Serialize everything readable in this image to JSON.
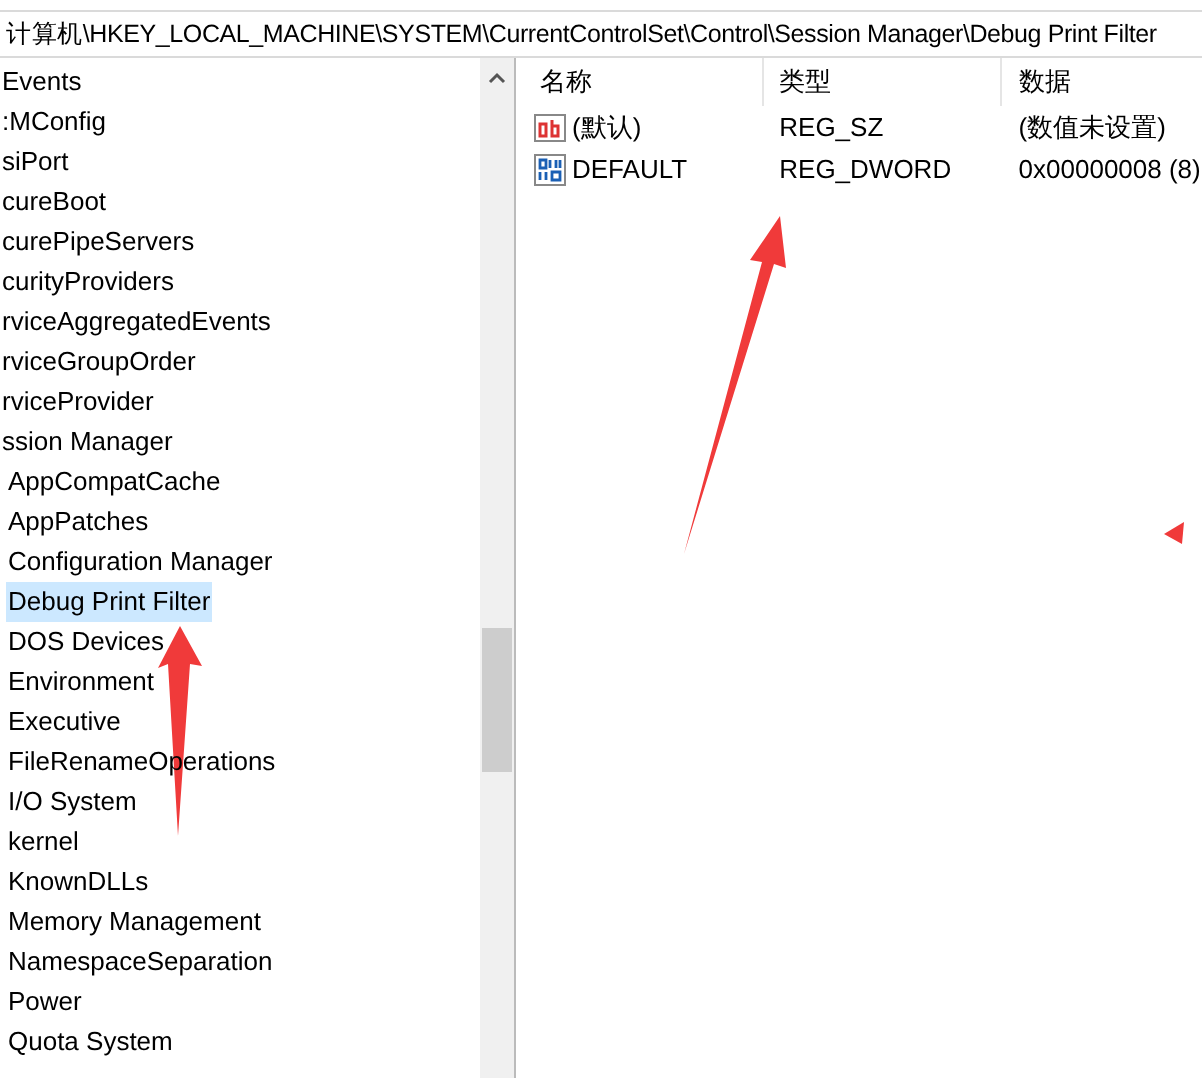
{
  "address_bar": {
    "path": "计算机\\HKEY_LOCAL_MACHINE\\SYSTEM\\CurrentControlSet\\Control\\Session Manager\\Debug Print Filter"
  },
  "tree": {
    "items": [
      {
        "label": "Events",
        "selected": false
      },
      {
        "label": ":MConfig",
        "selected": false
      },
      {
        "label": "siPort",
        "selected": false
      },
      {
        "label": "cureBoot",
        "selected": false
      },
      {
        "label": "curePipeServers",
        "selected": false
      },
      {
        "label": "curityProviders",
        "selected": false
      },
      {
        "label": "rviceAggregatedEvents",
        "selected": false
      },
      {
        "label": "rviceGroupOrder",
        "selected": false
      },
      {
        "label": "rviceProvider",
        "selected": false
      },
      {
        "label": "ssion Manager",
        "selected": false,
        "children": [
          {
            "label": "AppCompatCache",
            "selected": false
          },
          {
            "label": "AppPatches",
            "selected": false
          },
          {
            "label": "Configuration Manager",
            "selected": false
          },
          {
            "label": "Debug Print Filter",
            "selected": true
          },
          {
            "label": "DOS Devices",
            "selected": false
          },
          {
            "label": "Environment",
            "selected": false
          },
          {
            "label": "Executive",
            "selected": false
          },
          {
            "label": "FileRenameOperations",
            "selected": false
          },
          {
            "label": "I/O System",
            "selected": false
          },
          {
            "label": "kernel",
            "selected": false
          },
          {
            "label": "KnownDLLs",
            "selected": false
          },
          {
            "label": "Memory Management",
            "selected": false
          },
          {
            "label": "NamespaceSeparation",
            "selected": false
          },
          {
            "label": "Power",
            "selected": false
          },
          {
            "label": "Quota System",
            "selected": false
          }
        ]
      }
    ]
  },
  "values_table": {
    "columns": [
      "名称",
      "类型",
      "数据"
    ],
    "rows": [
      {
        "kind": "string",
        "name": "(默认)",
        "type": "REG_SZ",
        "data": "(数值未设置)"
      },
      {
        "kind": "binary",
        "name": "DEFAULT",
        "type": "REG_DWORD",
        "data": "0x00000008 (8)"
      }
    ]
  }
}
